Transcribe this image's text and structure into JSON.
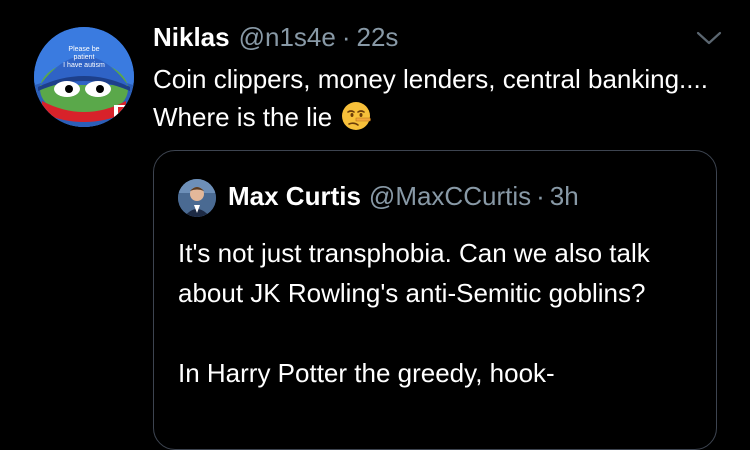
{
  "tweet": {
    "author_name": "Niklas",
    "handle": "@n1s4e",
    "separator": "·",
    "time": "22s",
    "text": "Coin clippers, money lenders, central banking.... Where is the lie",
    "emoji": "lying-face-emoji",
    "avatar_hat_text": "Please be patient I have autism"
  },
  "quote": {
    "author_name": "Max Curtis",
    "handle": "@MaxCCurtis",
    "separator": "·",
    "time": "3h",
    "paragraph_1": "It's not just transphobia. Can we also talk about JK Rowling's anti-Semitic goblins?",
    "paragraph_2": "In Harry Potter the greedy, hook-"
  },
  "colors": {
    "background": "#000000",
    "text": "#ffffff",
    "secondary": "#8899a6",
    "border": "#3d4450"
  }
}
